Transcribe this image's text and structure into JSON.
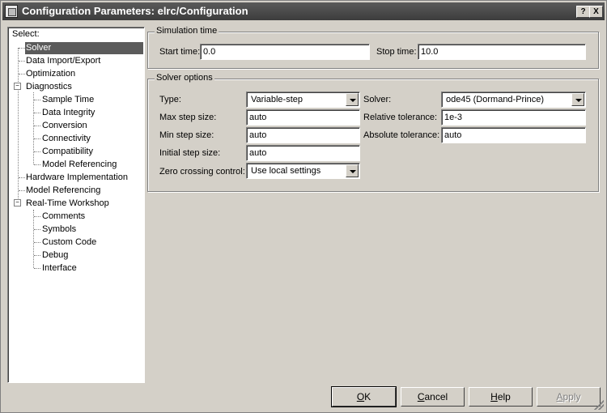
{
  "window": {
    "title": "Configuration Parameters: elrc/Configuration",
    "help_button": "?",
    "close_button": "X"
  },
  "sidebar": {
    "select_label": "Select:",
    "items": [
      {
        "label": "Solver",
        "selected": true
      },
      {
        "label": "Data Import/Export"
      },
      {
        "label": "Optimization"
      },
      {
        "label": "Diagnostics",
        "expanded": true
      },
      {
        "label": "Sample Time"
      },
      {
        "label": "Data Integrity"
      },
      {
        "label": "Conversion"
      },
      {
        "label": "Connectivity"
      },
      {
        "label": "Compatibility"
      },
      {
        "label": "Model Referencing"
      },
      {
        "label": "Hardware Implementation"
      },
      {
        "label": "Model Referencing"
      },
      {
        "label": "Real-Time Workshop",
        "expanded": true
      },
      {
        "label": "Comments"
      },
      {
        "label": "Symbols"
      },
      {
        "label": "Custom Code"
      },
      {
        "label": "Debug"
      },
      {
        "label": "Interface"
      }
    ]
  },
  "simulation_time": {
    "group_label": "Simulation time",
    "start_label": "Start time:",
    "start_value": "0.0",
    "stop_label": "Stop time:",
    "stop_value": "10.0"
  },
  "solver_options": {
    "group_label": "Solver options",
    "type_label": "Type:",
    "type_value": "Variable-step",
    "solver_label": "Solver:",
    "solver_value": "ode45 (Dormand-Prince)",
    "max_step_label": "Max step size:",
    "max_step_value": "auto",
    "rel_tol_label": "Relative tolerance:",
    "rel_tol_value": "1e-3",
    "min_step_label": "Min step size:",
    "min_step_value": "auto",
    "abs_tol_label": "Absolute tolerance:",
    "abs_tol_value": "auto",
    "init_step_label": "Initial step size:",
    "init_step_value": "auto",
    "zero_crossing_label": "Zero crossing control:",
    "zero_crossing_value": "Use local settings"
  },
  "buttons": {
    "ok_mnemonic": "O",
    "ok_rest": "K",
    "cancel_mnemonic": "C",
    "cancel_rest": "ancel",
    "help_mnemonic": "H",
    "help_rest": "elp",
    "apply_mnemonic": "A",
    "apply_rest": "pply"
  }
}
